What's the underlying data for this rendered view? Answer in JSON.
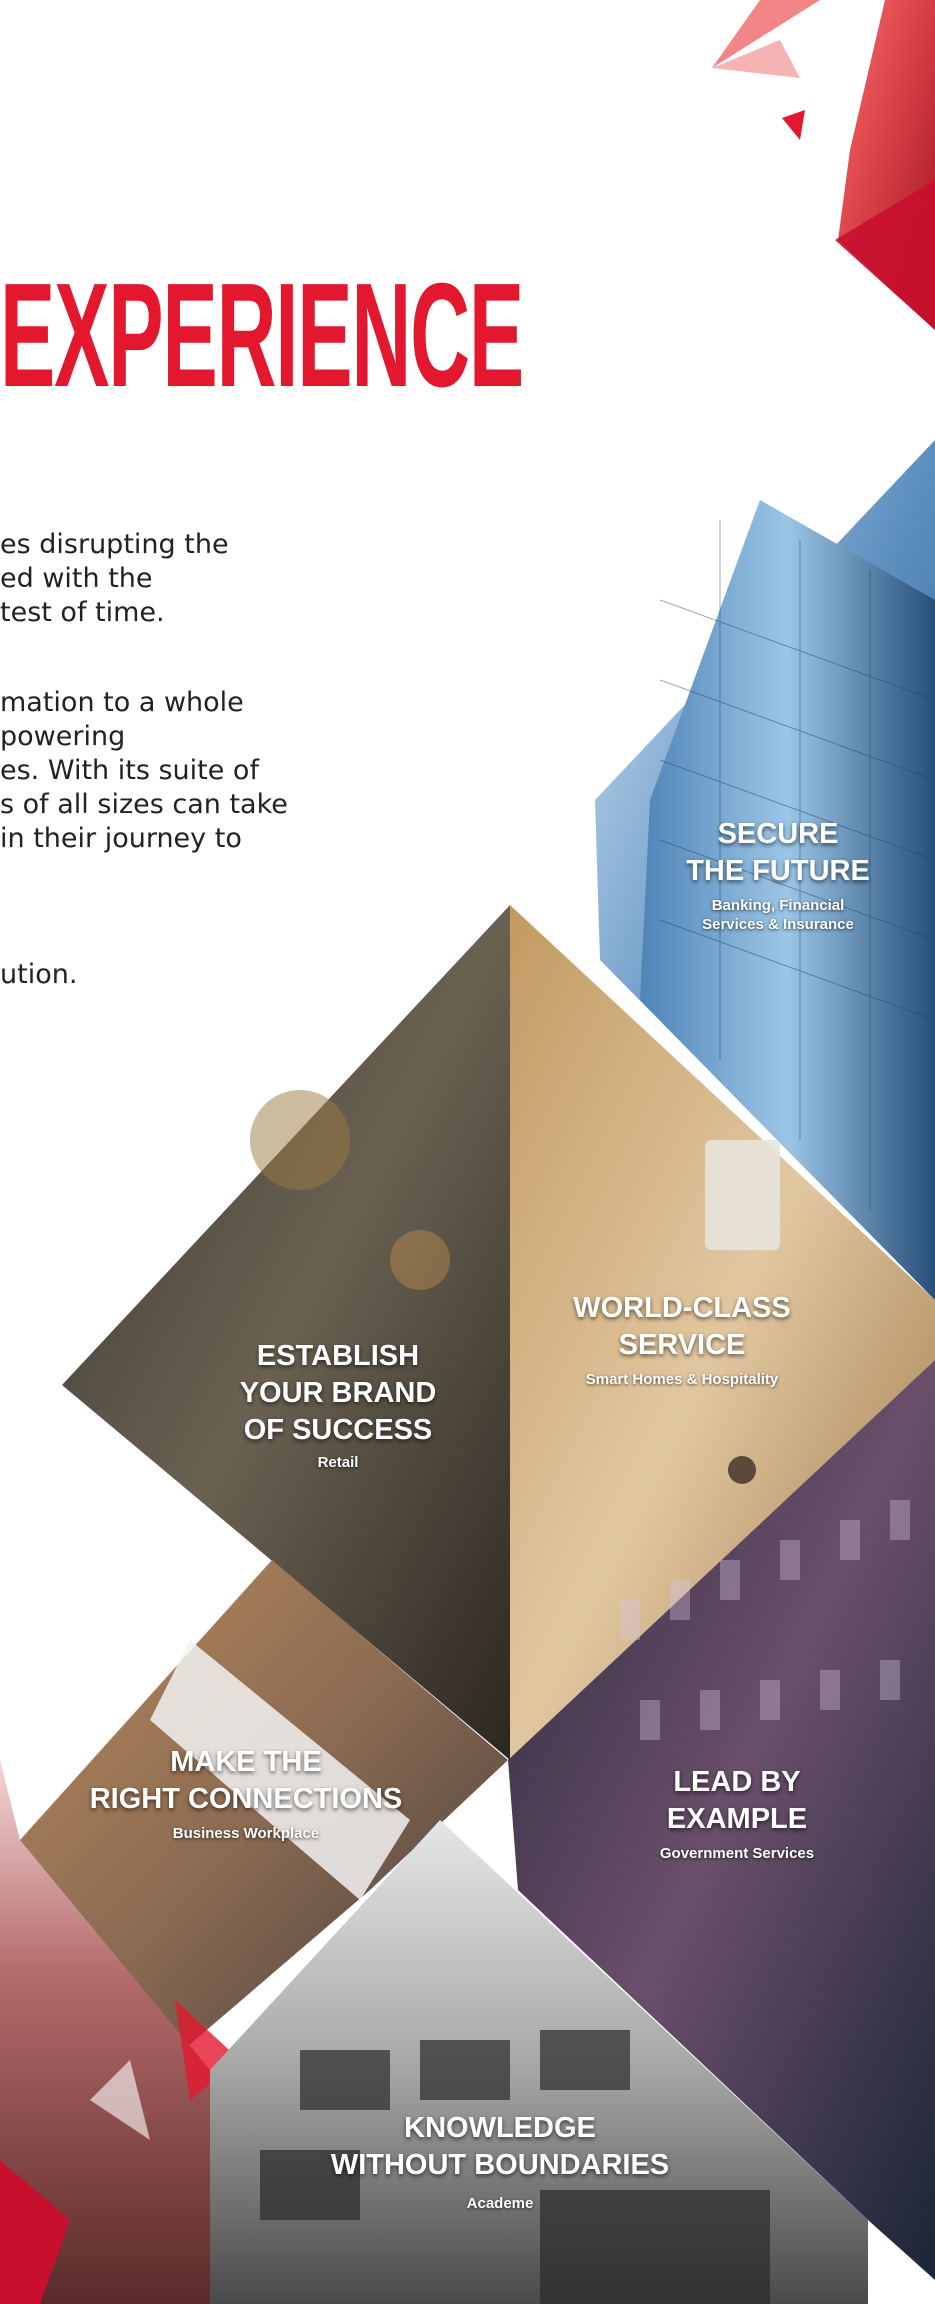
{
  "heading": "EXPERIENCE",
  "paragraphs": {
    "p1_l1": "es disrupting the",
    "p1_l2": "ed with the",
    "p1_l3": "test of time.",
    "p2_l1": "mation to a whole",
    "p2_l2": "powering",
    "p2_l3": "es. With its suite of",
    "p2_l4": "s of all sizes can take",
    "p2_l5": "in their journey to",
    "p3_l1": "ution."
  },
  "tiles": {
    "secure": {
      "title_l1": "SECURE",
      "title_l2": "THE FUTURE",
      "sub_l1": "Banking, Financial",
      "sub_l2": "Services & Insurance"
    },
    "world": {
      "title_l1": "WORLD-CLASS",
      "title_l2": "SERVICE",
      "sub": "Smart Homes & Hospitality"
    },
    "brand": {
      "title_l1": "ESTABLISH",
      "title_l2": "YOUR BRAND",
      "title_l3": "OF SUCCESS",
      "sub": "Retail"
    },
    "connect": {
      "title_l1": "MAKE THE",
      "title_l2": "RIGHT CONNECTIONS",
      "sub": "Business Workplace"
    },
    "lead": {
      "title_l1": "LEAD BY",
      "title_l2": "EXAMPLE",
      "sub": "Government Services"
    },
    "knowledge": {
      "title_l1": "KNOWLEDGE",
      "title_l2": "WITHOUT BOUNDARIES",
      "sub": "Academe"
    }
  },
  "colors": {
    "accent": "#e3182f",
    "text": "#222222"
  }
}
